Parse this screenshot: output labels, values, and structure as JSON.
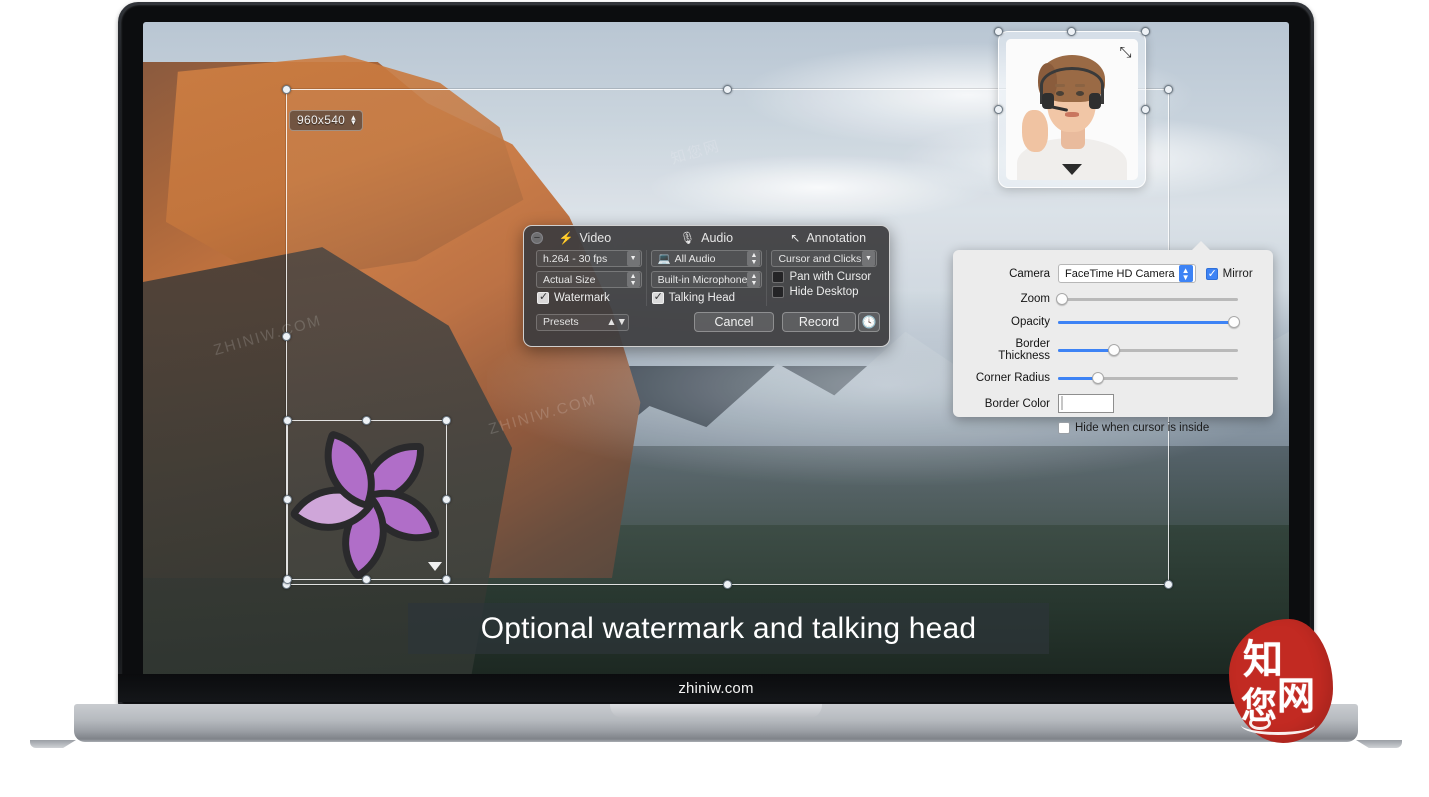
{
  "site": {
    "chinbar_label": "zhiniw.com"
  },
  "selection": {
    "resolution_label": "960x540",
    "stepper_up": "▴",
    "stepper_down": "▾"
  },
  "caption": {
    "text": "Optional watermark and talking head"
  },
  "camera_overlay": {
    "expand_icon": "⤡",
    "caret_icon": "camera-dropdown-caret"
  },
  "camera_settings": {
    "rows": [
      {
        "label": "Camera",
        "value": "FaceTime HD Camera"
      },
      {
        "label": "Zoom",
        "value": ""
      },
      {
        "label": "Opacity",
        "value": ""
      },
      {
        "label": "Border Thickness",
        "value": ""
      },
      {
        "label": "Corner Radius",
        "value": ""
      },
      {
        "label": "Border Color",
        "value": ""
      }
    ],
    "camera_label": "Camera",
    "camera_value": "FaceTime HD Camera",
    "mirror_label": "Mirror",
    "mirror_checked": true,
    "zoom_label": "Zoom",
    "zoom_percent": 0,
    "opacity_label": "Opacity",
    "opacity_percent": 100,
    "border_thickness_label": "Border Thickness",
    "border_thickness_percent": 31,
    "corner_radius_label": "Corner Radius",
    "corner_radius_percent": 22,
    "border_color_label": "Border Color",
    "border_color_value": "#ffffff",
    "hide_when_cursor_label": "Hide when cursor is inside",
    "hide_when_cursor_checked": false,
    "accent_color": "#3d83f5"
  },
  "recorder": {
    "close_glyph": "−",
    "columns": [
      {
        "icon": "⚡",
        "title": "Video"
      },
      {
        "icon": "🎙",
        "title": "Audio"
      },
      {
        "icon": "↖",
        "title": "Annotation"
      }
    ],
    "video": {
      "codec_value": "h.264 - 30 fps",
      "size_value": "Actual Size",
      "watermark_label": "Watermark",
      "watermark_checked": true
    },
    "audio": {
      "source_value": "All Audio",
      "source_icon": "💻",
      "device_value": "Built-in Microphone",
      "talking_head_label": "Talking Head",
      "talking_head_checked": true
    },
    "annotation": {
      "cursor_value": "Cursor and Clicks",
      "pan_label": "Pan with Cursor",
      "pan_checked": false,
      "hide_desktop_label": "Hide Desktop",
      "hide_desktop_checked": false
    },
    "footer": {
      "presets_value": "Presets",
      "cancel_label": "Cancel",
      "record_label": "Record",
      "timer_icon": "🕓"
    }
  },
  "seal": {
    "char1": "知",
    "char2": "网",
    "char3": "您"
  },
  "watermarks": {
    "a": "ZHINIW.COM",
    "b": "知您网",
    "c": "知您网"
  }
}
